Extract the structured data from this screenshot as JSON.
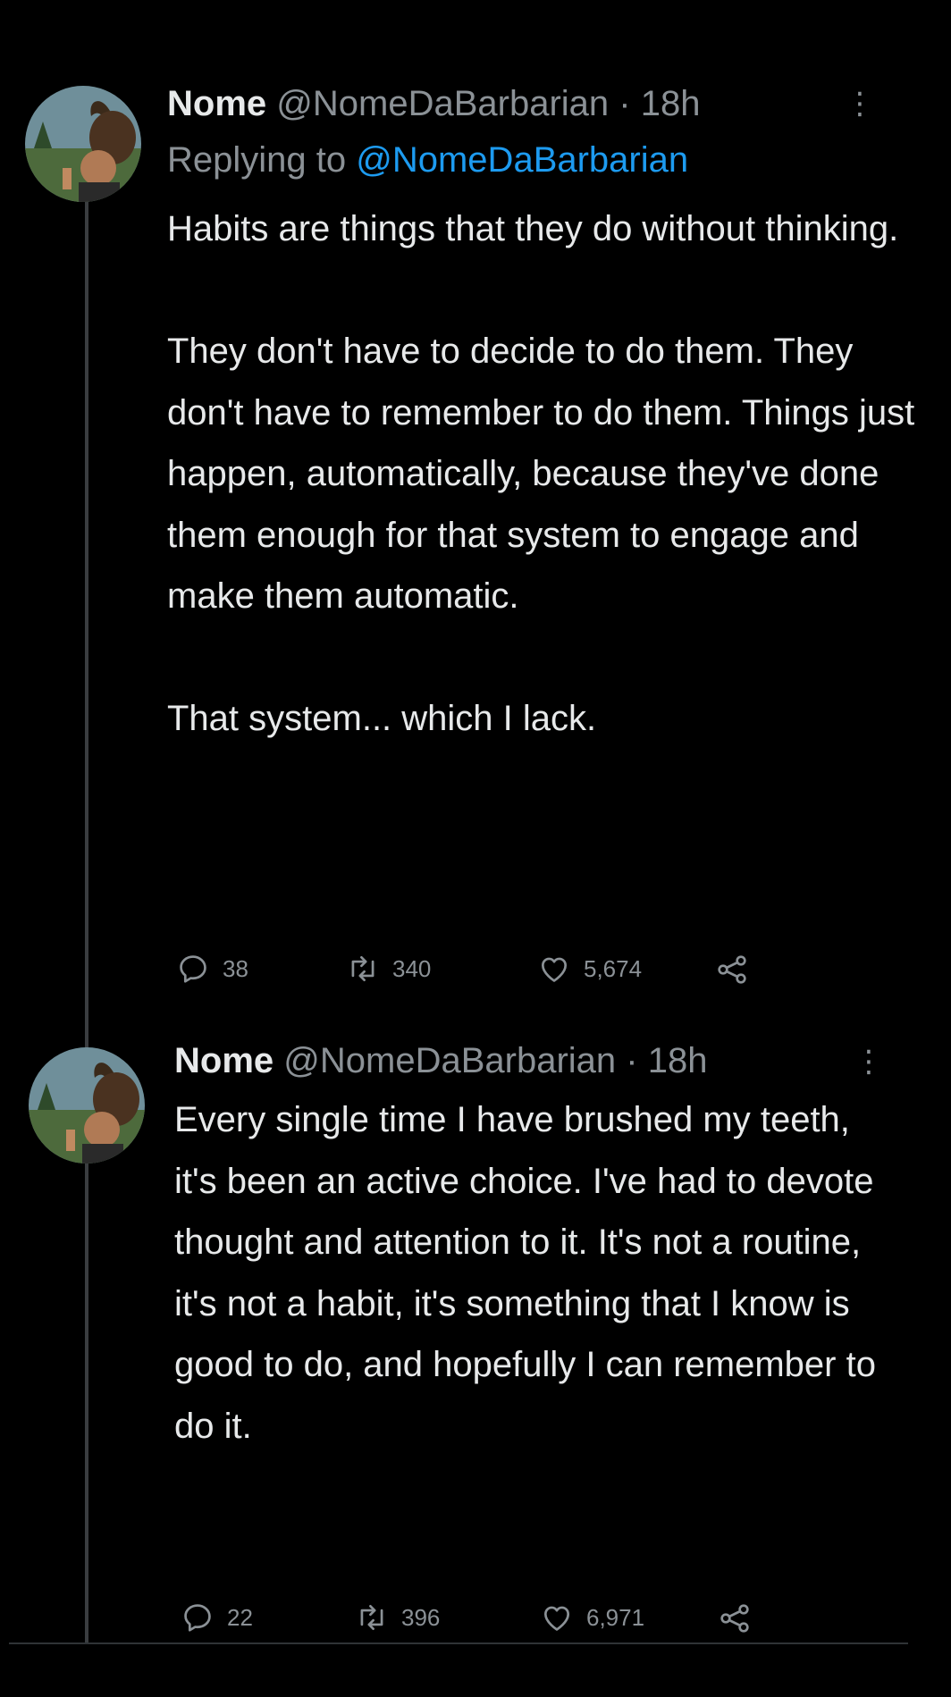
{
  "tweets": [
    {
      "name": "Nome",
      "handle": "@NomeDaBarbarian",
      "separator": "·",
      "time": "18h",
      "more_icon": "⋮",
      "replying_prefix": "Replying to",
      "replying_to": "@NomeDaBarbarian",
      "paragraphs": [
        "Habits are things that they do without thinking.",
        "They don't have to decide to do them. They don't have to remember to do them. Things just happen, automatically, because they've done them enough for that system to engage and make them automatic.",
        "That system... which I lack."
      ],
      "replies": "38",
      "retweets": "340",
      "likes": "5,674"
    },
    {
      "name": "Nome",
      "handle": "@NomeDaBarbarian",
      "separator": "·",
      "time": "18h",
      "more_icon": "⋮",
      "paragraphs": [
        "Every single time I have brushed my teeth, it's been an active choice. I've had to devote thought and attention to it. It's not a routine, it's not a habit, it's something that I know is good to do, and hopefully I can remember to do it."
      ],
      "replies": "22",
      "retweets": "396",
      "likes": "6,971"
    }
  ],
  "icons": {
    "reply": "reply-icon",
    "retweet": "retweet-icon",
    "like": "heart-icon",
    "share": "share-icon"
  },
  "colors": {
    "background": "#000000",
    "text": "#e7e9ea",
    "muted": "#8b9196",
    "link": "#1d9bf0"
  }
}
